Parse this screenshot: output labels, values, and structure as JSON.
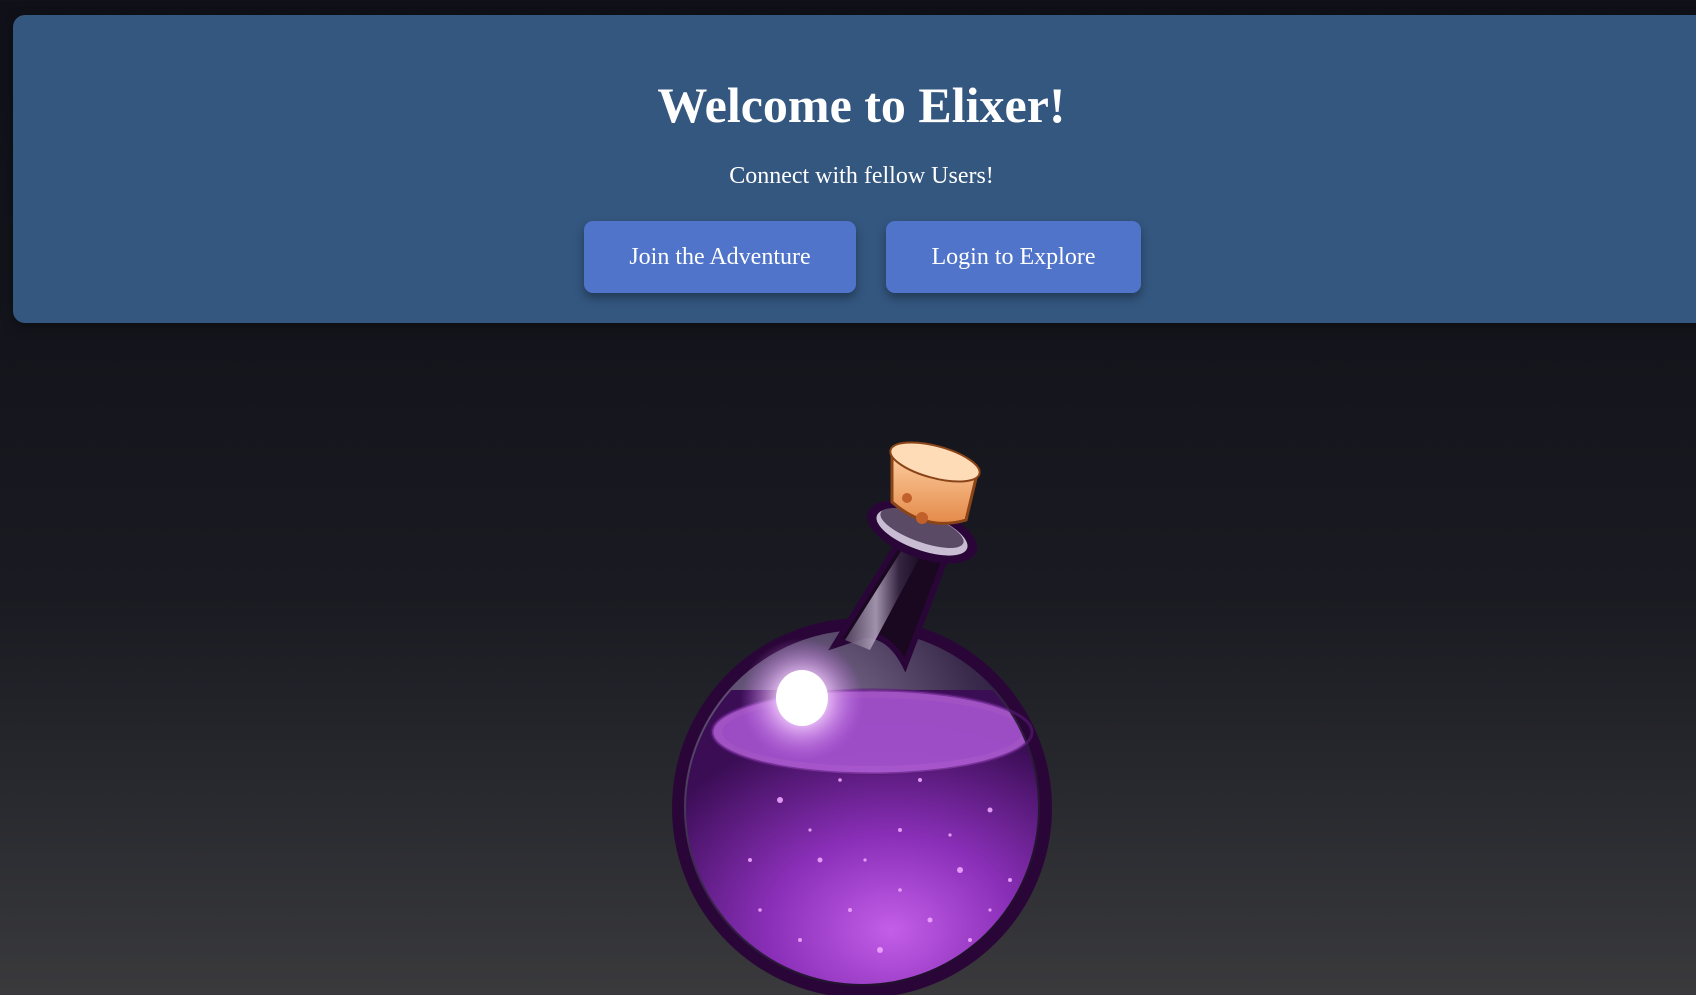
{
  "hero": {
    "title": "Welcome to Elixer!",
    "subtitle": "Connect with fellow Users!",
    "join_label": "Join the Adventure",
    "login_label": "Login to Explore"
  },
  "colors": {
    "hero_bg": "#345780",
    "button_bg": "#5074c9",
    "text": "#ffffff",
    "potion_liquid": "#9b3fd0",
    "cork": "#f0a566"
  },
  "illustration": {
    "icon": "potion-bottle-icon"
  }
}
